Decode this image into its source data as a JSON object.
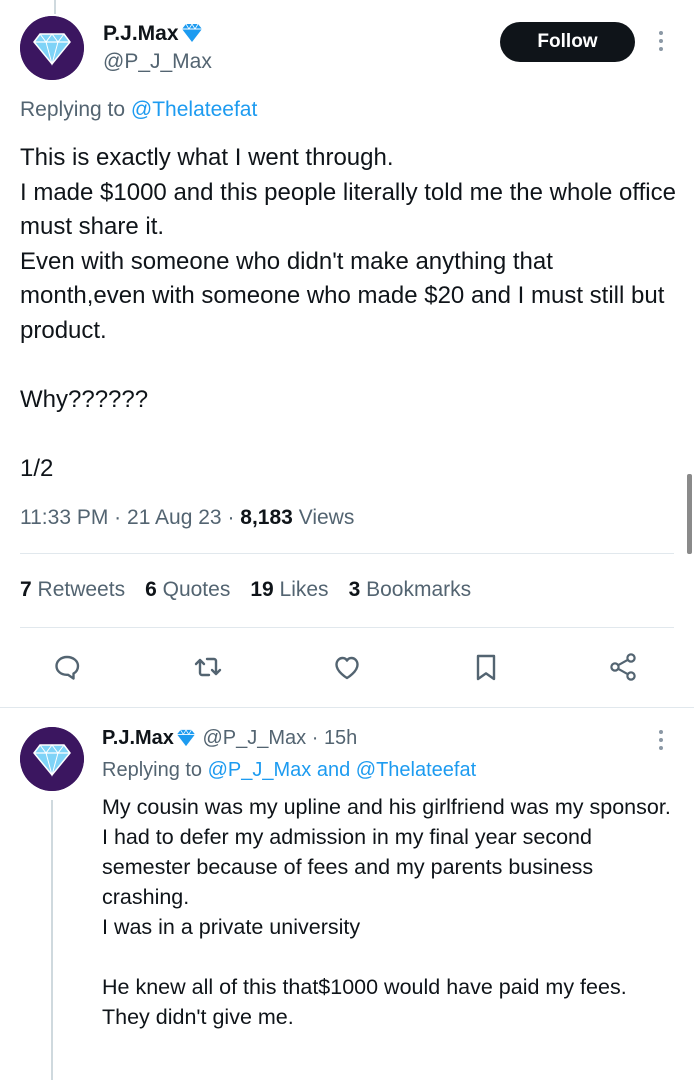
{
  "main_tweet": {
    "author_name": "P.J.Max",
    "author_handle": "@P_J_Max",
    "follow_label": "Follow",
    "replying_prefix": "Replying to ",
    "replying_to": "@Thelateefat",
    "text": "This is exactly what I went through.\nI made $1000 and this people literally told me the whole office must share it.\nEven with someone who didn't make anything that month,even with someone who made $20 and I must still but product.\n\nWhy??????\n\n1/2",
    "time": "11:33 PM",
    "date": "21 Aug 23",
    "views_count": "8,183",
    "views_label": "Views",
    "stats": {
      "retweets_count": "7",
      "retweets_label": "Retweets",
      "quotes_count": "6",
      "quotes_label": "Quotes",
      "likes_count": "19",
      "likes_label": "Likes",
      "bookmarks_count": "3",
      "bookmarks_label": "Bookmarks"
    },
    "actions": [
      "reply-icon",
      "retweet-icon",
      "like-icon",
      "bookmark-icon",
      "share-icon"
    ]
  },
  "reply_tweet": {
    "author_name": "P.J.Max",
    "author_handle": "@P_J_Max",
    "age": "15h",
    "replying_prefix": "Replying to ",
    "replying_to_1": "@P_J_Max",
    "replying_and": " and ",
    "replying_to_2": "@Thelateefat",
    "text": "My cousin was my upline and his girlfriend was my sponsor.\nI had to defer my admission in my final year second semester because of fees and my parents business crashing.\nI was in a private university\n\nHe knew all of this that$1000 would have paid my fees.\nThey didn't give me."
  },
  "colors": {
    "accent": "#1d9bf0",
    "text_primary": "#0f1419",
    "text_secondary": "#536471",
    "verified": "#1d9bf0",
    "avatar_bg": "#3b1660"
  }
}
